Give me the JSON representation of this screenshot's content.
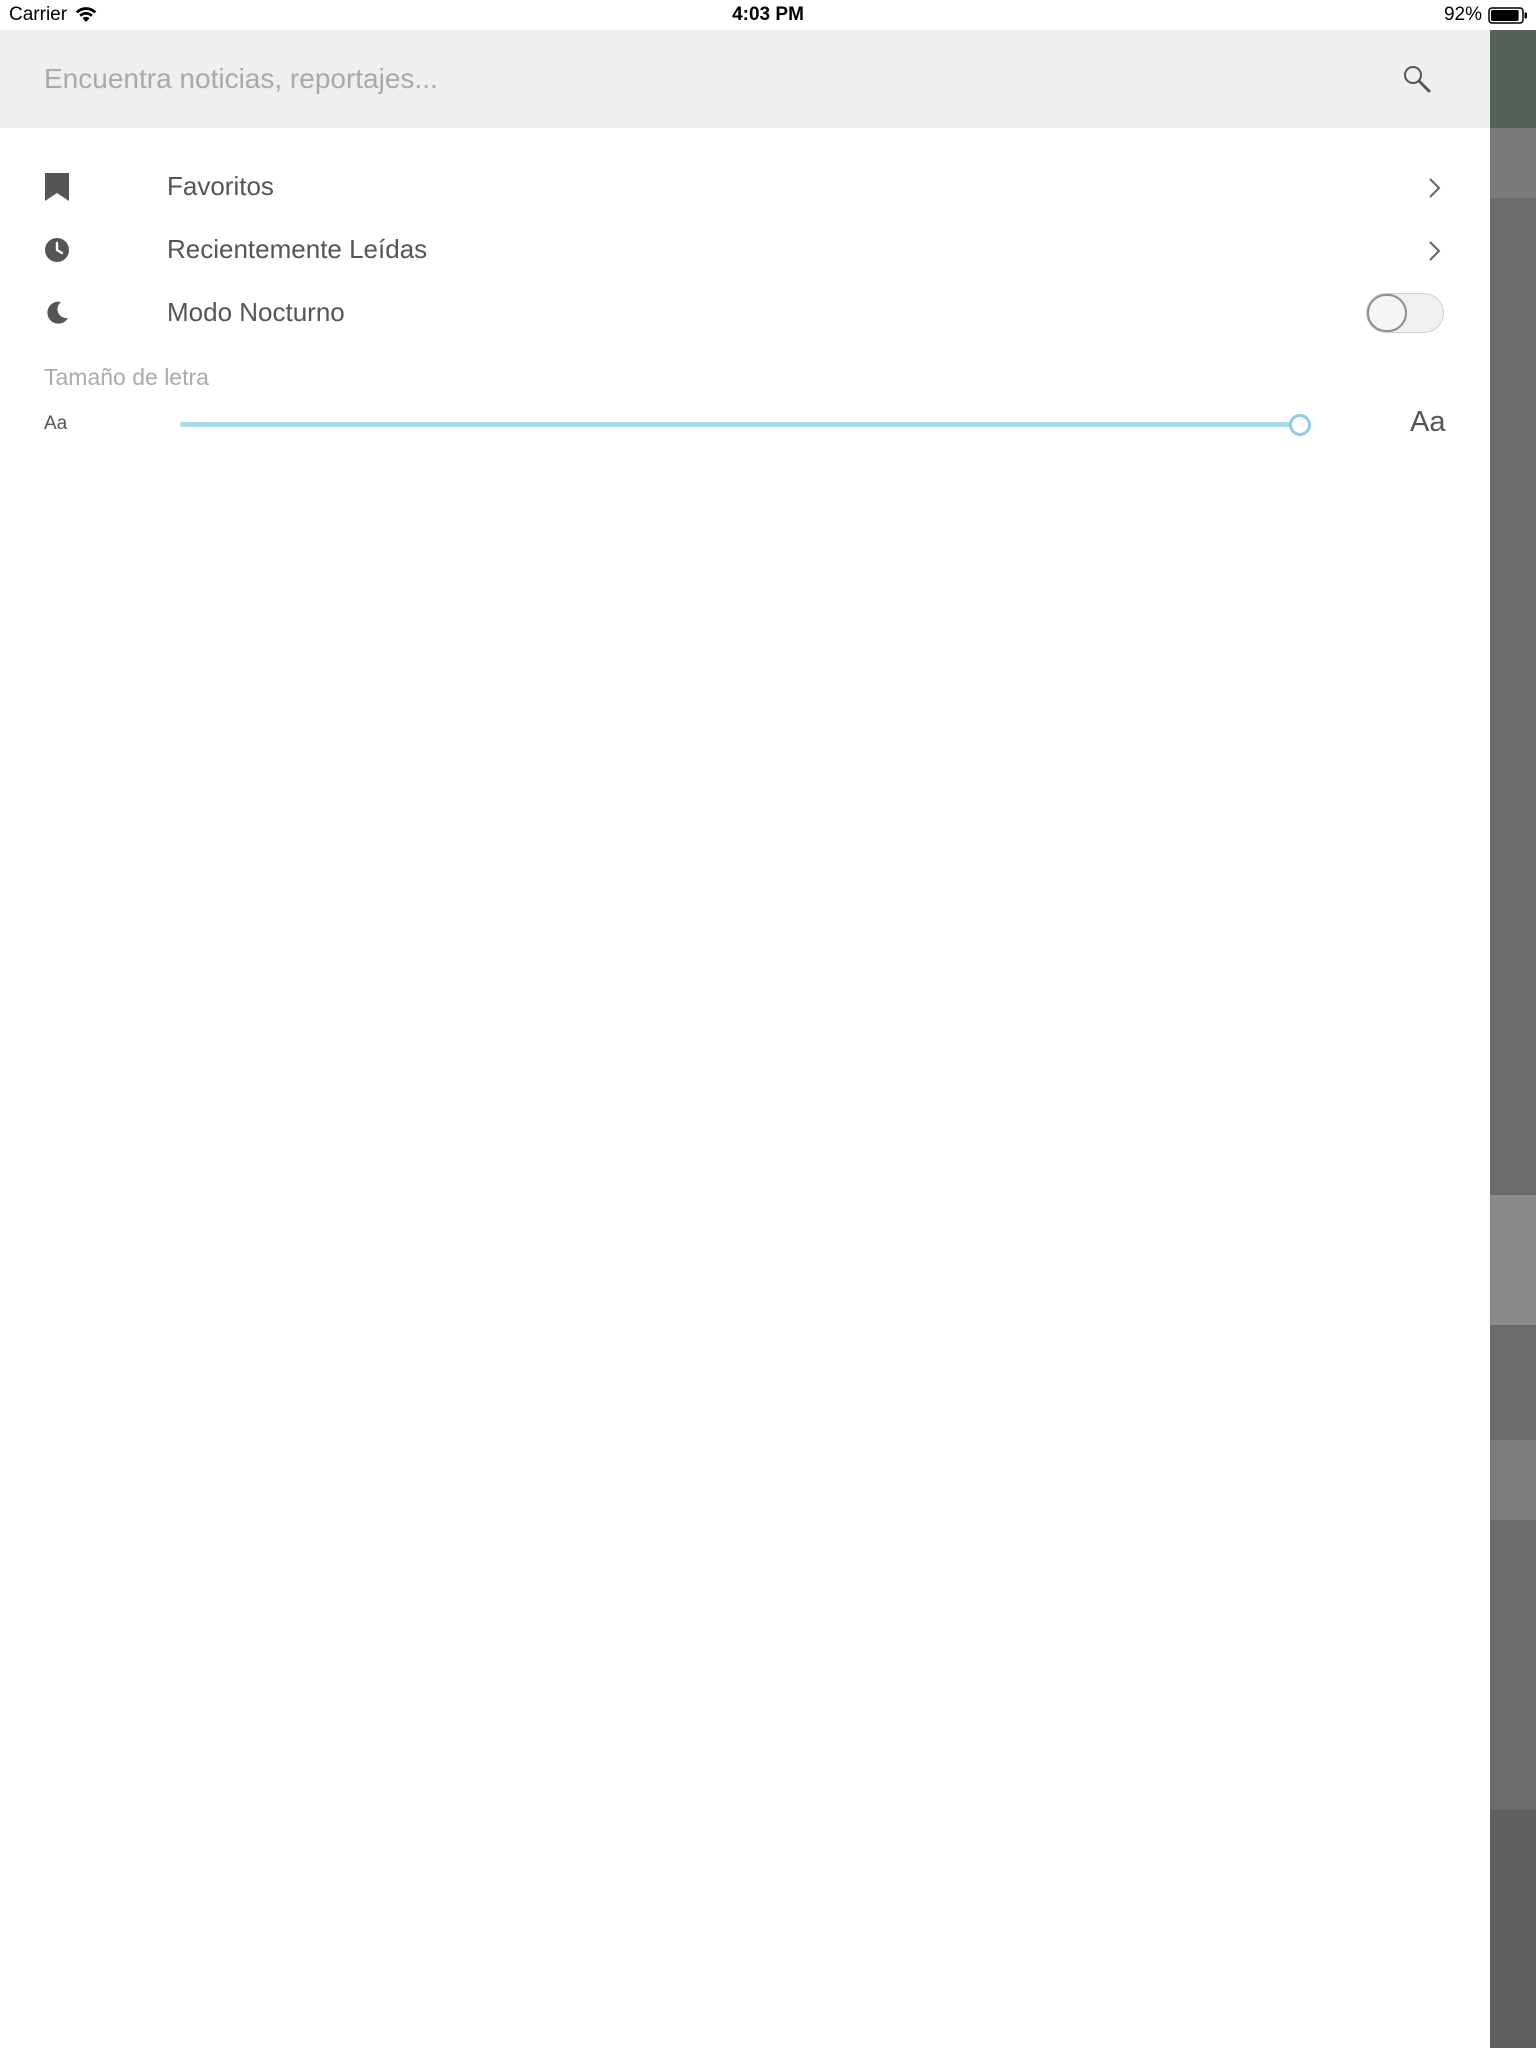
{
  "status_bar": {
    "carrier": "Carrier",
    "time": "4:03 PM",
    "battery_percent": "92%",
    "battery_level": 0.92
  },
  "search": {
    "placeholder": "Encuentra noticias, reportajes...",
    "value": ""
  },
  "menu": {
    "items": [
      {
        "label": "Favoritos",
        "icon": "bookmark-icon"
      },
      {
        "label": "Recientemente Leídas",
        "icon": "clock-icon"
      },
      {
        "label": "Modo Nocturno",
        "icon": "moon-icon"
      }
    ]
  },
  "night_mode": {
    "enabled": false
  },
  "font_size": {
    "label": "Tamaño de letra",
    "small_label": "Aa",
    "large_label": "Aa",
    "level": 1.0
  },
  "colors": {
    "accent": "#add9ec",
    "search_bar_bg": "#efefef",
    "text": "#555555",
    "muted_text": "#aaaaaa"
  }
}
